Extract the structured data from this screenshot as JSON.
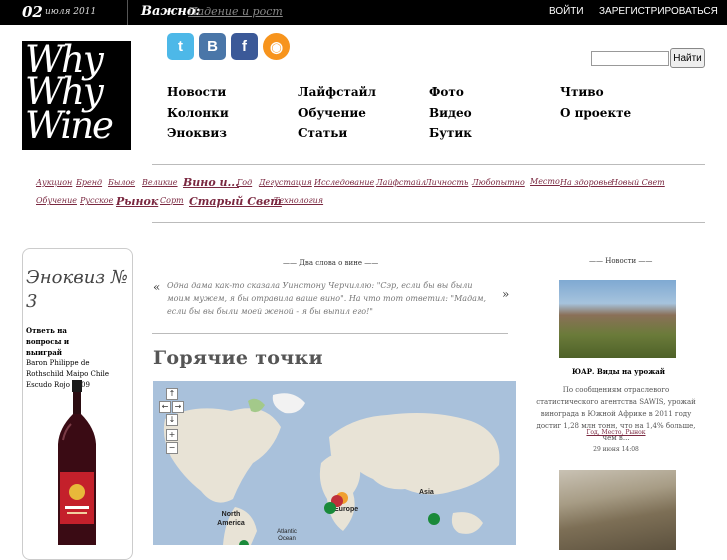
{
  "topbar": {
    "day": "02",
    "month_year": "июля 2011",
    "important_label": "Важно:",
    "important_link": "Падение и рост",
    "login": "ВОЙТИ",
    "register": "ЗАРЕГИСТРИРОВАТЬСЯ"
  },
  "logo": {
    "line1": "Why",
    "line2": "Why",
    "line3": "Wine"
  },
  "social": {
    "twitter": "t",
    "vkontakte": "B",
    "facebook": "f",
    "rss": "◉"
  },
  "search": {
    "button": "Найти",
    "value": ""
  },
  "nav": {
    "col1": [
      "Новости",
      "Колонки",
      "Эноквиз"
    ],
    "col2": [
      "Лайфстайл",
      "Обучение",
      "Статьи"
    ],
    "col3": [
      "Фото",
      "Видео",
      "Бутик"
    ],
    "col4": [
      "Чтиво",
      "О проекте"
    ]
  },
  "tags": {
    "row1": [
      "Аукцион",
      "Бренд",
      "Былое",
      "Великие",
      "Вино и...",
      "Год",
      "Дегустация",
      "Исследование",
      "Лайфстайл",
      "Личность",
      "Любопытно",
      "Место",
      "На здоровье",
      "Новый Свет"
    ],
    "row2": [
      "Обучение",
      "Русское",
      "Рынок",
      "Сорт",
      "Старый Свет",
      "Технология"
    ]
  },
  "quiz": {
    "title": "Эноквиз № 3",
    "line1": "Ответь на",
    "line2": "вопросы и",
    "line3": "выиграй",
    "prize": "Baron Philippe de Rothschild Maipo Chile Escudo Rojo 2009"
  },
  "center": {
    "section_label": "—— Два слова о вине ——",
    "quote_open": "«",
    "quote_close": "»",
    "quote": "Одна дама как-то сказала Уинстону Черчиллю: \"Сэр, если бы вы были моим мужем, я бы отравила ваше вино\". На что тот ответил: \"Мадам, если бы вы были моей женой - я бы выпил его!\"",
    "hot_title": "Горячие точки"
  },
  "map": {
    "labels": {
      "asia": "Asia",
      "europe": "Europe",
      "north_america": "North America",
      "atlantic": "Atlantic Ocean"
    },
    "controls": {
      "up": "↑",
      "left": "←",
      "right": "→",
      "down": "↓",
      "zoom_in": "+",
      "zoom_out": "−"
    }
  },
  "news": {
    "section_label": "—— Новости ——",
    "title": "ЮАР. Виды на урожай",
    "body": "По сообщениям отраслевого статистического агентства SAWIS, урожай винограда в Южной Африке в 2011 году достиг 1,28 млн тонн, что на 1,4% больше, чем в...",
    "tags": "Год, Место, Рынок",
    "date": "29 июня 14:08"
  }
}
